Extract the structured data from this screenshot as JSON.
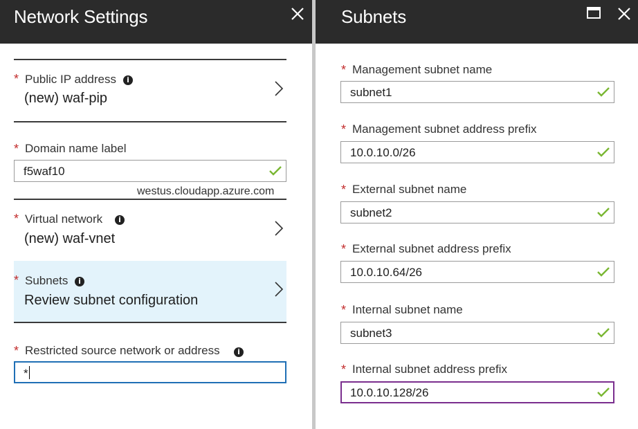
{
  "left_blade": {
    "title": "Network Settings",
    "public_ip": {
      "label": "Public IP address",
      "value": "(new) waf-pip"
    },
    "domain_name": {
      "label": "Domain name label",
      "value": "f5waf10",
      "hint": "westus.cloudapp.azure.com"
    },
    "virtual_network": {
      "label": "Virtual network",
      "value": "(new) waf-vnet"
    },
    "subnets": {
      "label": "Subnets",
      "value": "Review subnet configuration"
    },
    "restricted": {
      "label": "Restricted source network or address",
      "value": "*"
    }
  },
  "right_blade": {
    "title": "Subnets",
    "fields": [
      {
        "label": "Management subnet name",
        "value": "subnet1"
      },
      {
        "label": "Management subnet address prefix",
        "value": "10.0.10.0/26"
      },
      {
        "label": "External subnet name",
        "value": "subnet2"
      },
      {
        "label": "External subnet address prefix",
        "value": "10.0.10.64/26"
      },
      {
        "label": "Internal subnet name",
        "value": "subnet3"
      },
      {
        "label": "Internal subnet address prefix",
        "value": "10.0.10.128/26"
      }
    ]
  },
  "required_marker": "*",
  "info_glyph": "i",
  "colors": {
    "header_bg": "#2b2b2b",
    "required": "#c22c2c",
    "valid_check": "#7ab733",
    "selected_row": "#e3f3fb",
    "focus_blue": "#1f6fb5",
    "focus_purple": "#7a2e8e"
  },
  "icons": [
    "close-icon",
    "maximize-icon",
    "info-icon",
    "chevron-right-icon",
    "checkmark-icon"
  ]
}
